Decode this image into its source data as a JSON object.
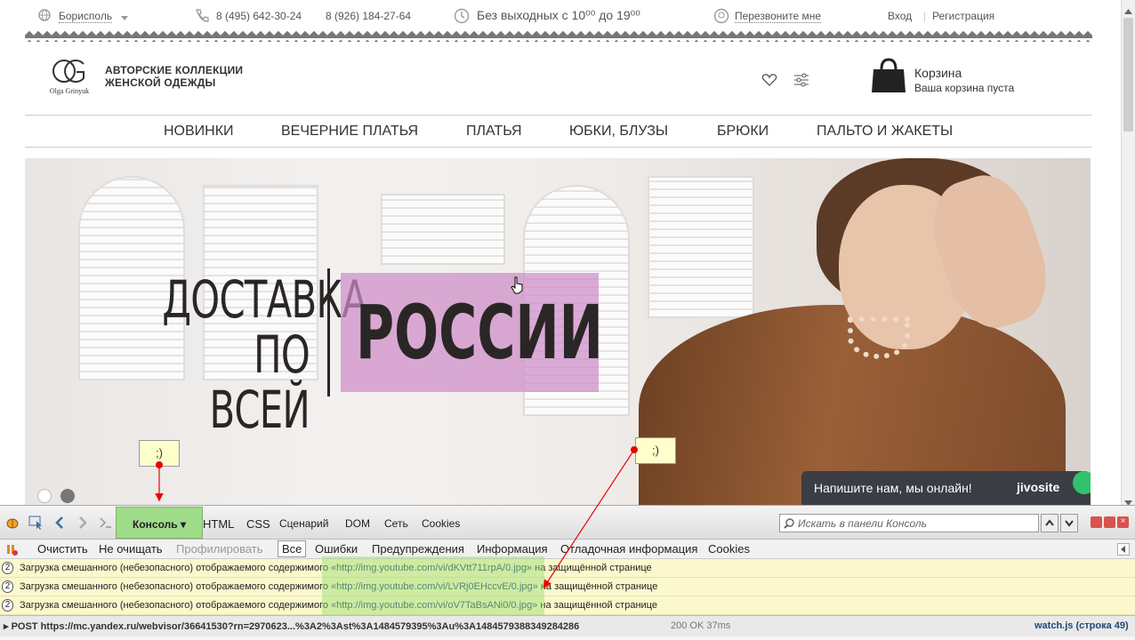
{
  "topbar": {
    "city": "Борисполь",
    "phone1": "8 (495) 642-30-24",
    "phone2": "8 (926) 184-27-64",
    "hours": "Без выходных с 10⁰⁰ до 19⁰⁰",
    "callback": "Перезвоните мне",
    "login": "Вход",
    "register": "Регистрация"
  },
  "logo": {
    "brand": "Olga Grinyuk",
    "tagline1": "АВТОРСКИЕ КОЛЛЕКЦИИ",
    "tagline2": "ЖЕНСКОЙ ОДЕЖДЫ"
  },
  "cart": {
    "title": "Корзина",
    "status": "Ваша корзина пуста"
  },
  "nav": {
    "items": [
      "НОВИНКИ",
      "ВЕЧЕРНИЕ ПЛАТЬЯ",
      "ПЛАТЬЯ",
      "ЮБКИ, БЛУЗЫ",
      "БРЮКИ",
      "ПАЛЬТО И ЖАКЕТЫ"
    ]
  },
  "hero": {
    "line1": "ДОСТАВКА",
    "line2": "ПО ВСЕЙ",
    "highlight": "РОССИИ"
  },
  "chat": {
    "message": "Напишите нам, мы онлайн!",
    "brand": "jivosite"
  },
  "annotations": {
    "note1": ";)",
    "note2": ";)"
  },
  "firebug": {
    "tabs": [
      "Консоль",
      "HTML",
      "CSS",
      "Сценарий",
      "DOM",
      "Сеть",
      "Cookies"
    ],
    "search_placeholder": "Искать в панели Консоль",
    "toolbar": [
      "Очистить",
      "Не очищать",
      "Профилировать",
      "Все",
      "Ошибки",
      "Предупреждения",
      "Информация",
      "Отладочная информация",
      "Cookies"
    ],
    "rows": [
      {
        "count": "2",
        "prefix": "Загрузка смешанного (небезопасного) отображаемого содержимого ",
        "url": "«http://img.youtube.com/vi/dKVtt711rpA/0.jpg»",
        "suffix": " на защищённой странице"
      },
      {
        "count": "2",
        "prefix": "Загрузка смешанного (небезопасного) отображаемого содержимого ",
        "url": "«http://img.youtube.com/vi/LVRj0EHccvE/0.jpg»",
        "suffix": " на защищённой странице"
      },
      {
        "count": "2",
        "prefix": "Загрузка смешанного (небезопасного) отображаемого содержимого ",
        "url": "«http://img.youtube.com/vi/oV7TaBsANi0/0.jpg»",
        "suffix": " на защищённой странице"
      }
    ],
    "status": {
      "request": "POST https://mc.yandex.ru/webvisor/36641530?rn=2970623...%3A2%3Ast%3A1484579395%3Au%3A1484579388349284286",
      "result": "200 OK 37ms",
      "source": "watch.js (строка 49)"
    }
  },
  "colors": {
    "accent_pink": "#cd8cc8",
    "console_tab": "#9fdc8a",
    "warning_row": "#fbf8cd",
    "chat_bg": "#3a3d44",
    "jivo_green": "#2fc36b"
  }
}
